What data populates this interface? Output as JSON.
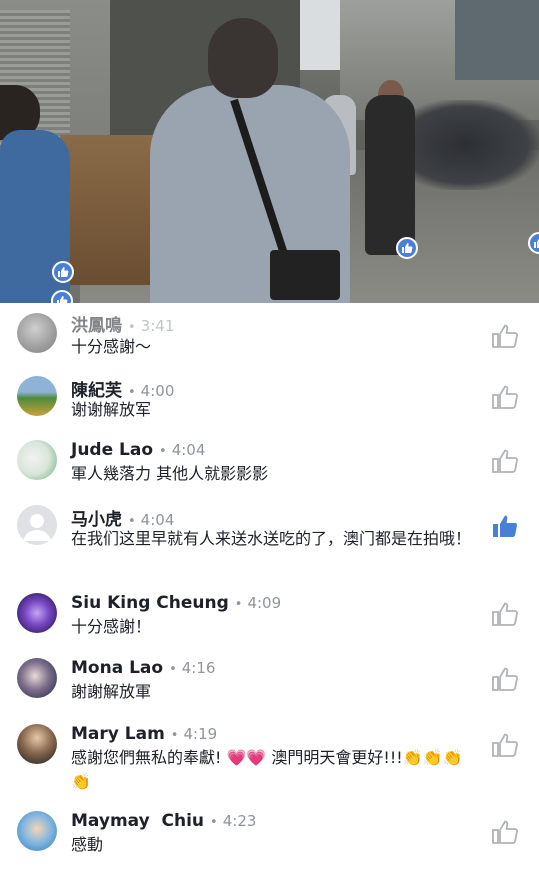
{
  "video": {
    "reaction_icon": "like-icon",
    "reaction_color": "#4a7fd8"
  },
  "comments": [
    {
      "name": "洪鳳鳴",
      "separator": "•",
      "time": "3:41",
      "text": "十分感謝～",
      "liked": false,
      "avatar_color": "#9a9a9a"
    },
    {
      "name": "陳紀芙",
      "separator": "•",
      "time": "4:00",
      "text": "谢谢解放军",
      "liked": false,
      "avatar_color": "#5f8f5a"
    },
    {
      "name": "Jude Lao",
      "separator": "•",
      "time": "4:04",
      "text": "軍人幾落力 其他人就影影影",
      "liked": false,
      "avatar_color": "#6aa87c"
    },
    {
      "name": "马小虎",
      "separator": "•",
      "time": "4:04",
      "text": "在我们这里早就有人来送水送吃的了，澳门都是在拍哦！",
      "liked": true,
      "avatar_color": "#d4d6db"
    },
    {
      "name": "Siu King Cheung",
      "separator": "•",
      "time": "4:09",
      "text": "十分感謝！",
      "liked": false,
      "avatar_color": "#6b3fa8"
    },
    {
      "name": "Mona Lao",
      "separator": "•",
      "time": "4:16",
      "text": "謝謝解放軍",
      "liked": false,
      "avatar_color": "#3b3f66"
    },
    {
      "name": "Mary Lam",
      "separator": "•",
      "time": "4:19",
      "text": "感謝您們無私的奉獻! 💗💗 澳門明天會更好!!!👏👏👏👏",
      "liked": false,
      "avatar_color": "#5a4a3c"
    },
    {
      "name": "Maymay  Chiu",
      "separator": "•",
      "time": "4:23",
      "text": "感動",
      "liked": false,
      "avatar_color": "#4a90c8"
    }
  ],
  "colors": {
    "name": "#1d2129",
    "meta": "#90949c",
    "like_active": "#4a7fd8",
    "like_inactive": "#b0b3b8"
  }
}
